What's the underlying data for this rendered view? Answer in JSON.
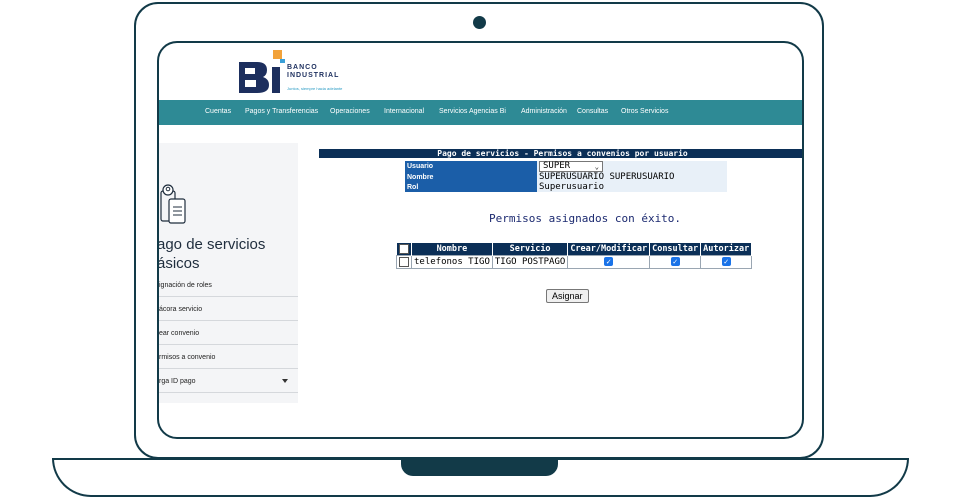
{
  "brand": {
    "name_line1": "BANCO",
    "name_line2": "INDUSTRIAL",
    "tagline": "Juntos, siempre hacia adelante"
  },
  "nav": [
    "Cuentas",
    "Pagos y Transferencias",
    "Operaciones",
    "Internacional",
    "Servicios Agencias Bi",
    "Administración",
    "Consultas",
    "Otros Servicios"
  ],
  "sidebar": {
    "title_line1": "ago de servicios",
    "title_line2": "ásicos",
    "items": [
      "ignación de roles",
      "ácora servicio",
      "ear convenio",
      "rmisos a convenio",
      "rga ID pago"
    ]
  },
  "panel": {
    "title": "Pago de servicios - Permisos a convenios por usuario",
    "usuario_label": "Usuario",
    "usuario_value": "SUPER",
    "nombre_label": "Nombre",
    "nombre_value": "SUPERUSUARIO SUPERUSUARIO",
    "rol_label": "Rol",
    "rol_value": "Superusuario",
    "success_message": "Permisos asignados con éxito.",
    "table": {
      "headers": [
        "Nombre",
        "Servicio",
        "Crear/Modificar",
        "Consultar",
        "Autorizar"
      ],
      "rows": [
        {
          "nombre": "telefonos TIGO",
          "servicio": "TIGO POSTPAGO",
          "crear": true,
          "consultar": true,
          "autorizar": true
        }
      ]
    },
    "assign_button": "Asignar"
  },
  "colors": {
    "frame": "#123a48",
    "navbar": "#2e8a95",
    "header_dark": "#0b2f57",
    "label_blue": "#1b5ea8",
    "checkbox_checked": "#1a73e8"
  }
}
